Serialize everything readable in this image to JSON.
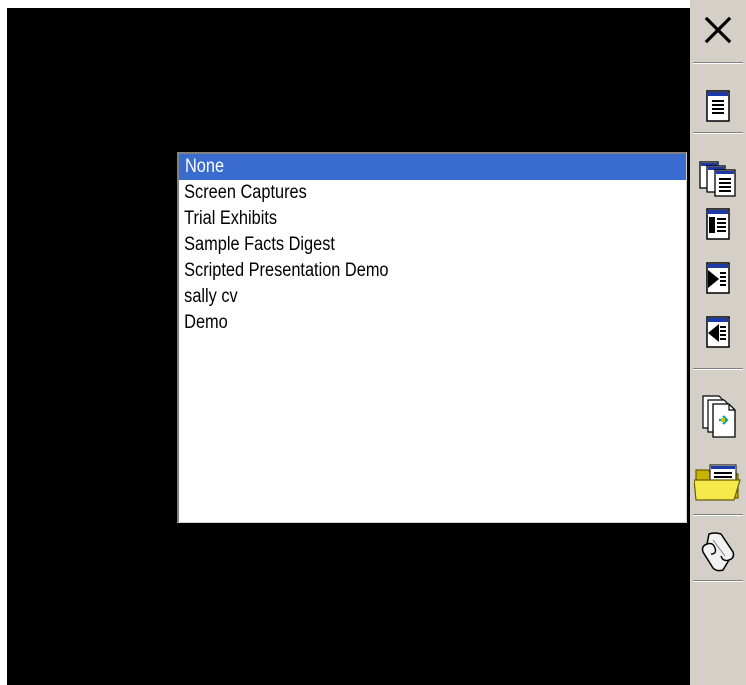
{
  "list": {
    "items": [
      {
        "label": "None",
        "selected": true
      },
      {
        "label": "Screen Captures",
        "selected": false
      },
      {
        "label": "Trial Exhibits",
        "selected": false
      },
      {
        "label": "Sample Facts Digest",
        "selected": false
      },
      {
        "label": "Scripted Presentation Demo",
        "selected": false
      },
      {
        "label": "sally cv",
        "selected": false
      },
      {
        "label": "Demo",
        "selected": false
      }
    ]
  },
  "toolbar": {
    "buttons": [
      "close-icon",
      "document-icon",
      "multi-document-icon",
      "document-left-marker-icon",
      "document-next-icon",
      "document-prev-icon",
      "file-copy-icon",
      "open-folder-icon",
      "script-scroll-icon"
    ]
  },
  "colors": {
    "background": "#000000",
    "selection": "#3a6ccf",
    "toolbar": "#d4d0c8"
  }
}
